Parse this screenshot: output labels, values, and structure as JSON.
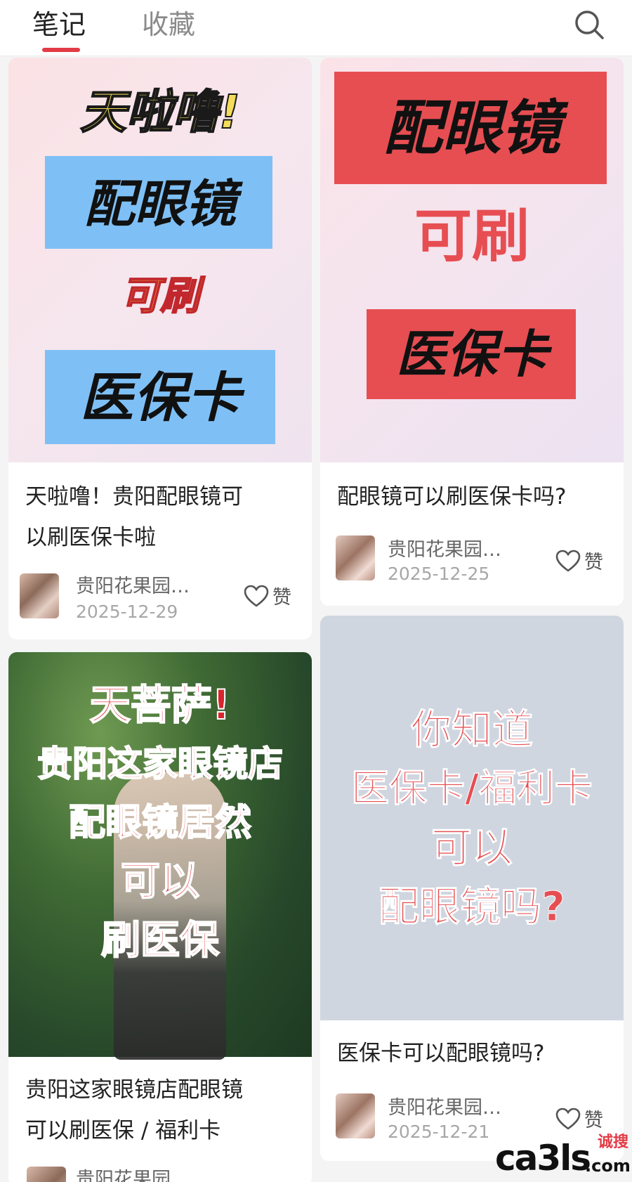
{
  "tabs": {
    "notes": "笔记",
    "favorites": "收藏"
  },
  "cards": [
    {
      "poster": {
        "l1": "天啦噜!",
        "l2": "配眼镜",
        "l3": "可刷",
        "l4": "医保卡"
      },
      "title_line1": "天啦噜！贵阳配眼镜可",
      "title_line2": "以刷医保卡啦",
      "author": "贵阳花果园…",
      "date": "2025-12-29",
      "like": "赞"
    },
    {
      "poster": {
        "l1": "配眼镜",
        "l2": "可刷",
        "l3": "医保卡"
      },
      "title_line1": "配眼镜可以刷医保卡吗?",
      "author": "贵阳花果园…",
      "date": "2025-12-25",
      "like": "赞"
    },
    {
      "poster": {
        "l1": "天菩萨!",
        "l2": "贵阳这家眼镜店",
        "l3": "配眼镜居然",
        "l4": "可以",
        "l5": "刷医保"
      },
      "title_line1": "贵阳这家眼镜店配眼镜",
      "title_line2": "可以刷医保 / 福利卡",
      "author": "贵阳花果园"
    },
    {
      "poster": {
        "l1": "你知道",
        "l2": "医保卡/福利卡",
        "l3": "可以",
        "l4": "配眼镜吗?"
      },
      "title_line1": "医保卡可以配眼镜吗?",
      "author": "贵阳花果园…",
      "date": "2025-12-21",
      "like": "赞"
    }
  ],
  "watermark": {
    "brand": "ca3ls",
    "cn": "诚搜",
    "suffix": ".com"
  },
  "colors": {
    "accent": "#e23b45",
    "poster_red": "#e64e52",
    "poster_blue": "#7ec0f6",
    "poster_gray": "#cfd6e0"
  }
}
